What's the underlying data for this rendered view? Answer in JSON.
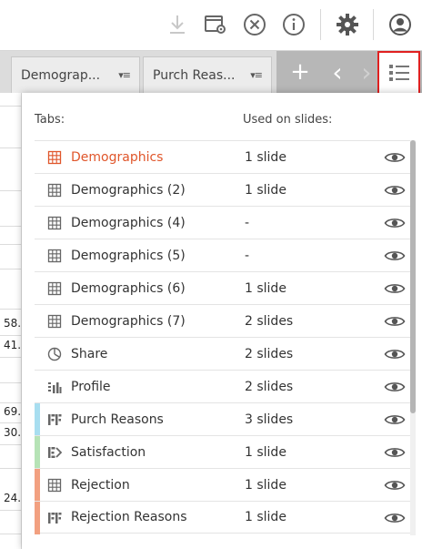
{
  "toolbar": {
    "icons": [
      "download-icon",
      "settings-window-icon",
      "close-circle-icon",
      "info-icon",
      "gear-icon",
      "user-icon"
    ]
  },
  "tabs": [
    {
      "label": "Demograp...",
      "menu_glyph": "▾≡"
    },
    {
      "label": "Purch Reas...",
      "menu_glyph": "▾≡"
    }
  ],
  "tab_controls": {
    "add": "+",
    "prev": "‹",
    "next": "›"
  },
  "background_sheet": {
    "values": [
      "58.",
      "41.",
      "69.",
      "30.",
      "24."
    ]
  },
  "popup": {
    "header_tabs": "Tabs:",
    "header_used": "Used on slides:",
    "rows": [
      {
        "name": "Demographics",
        "used": "1 slide",
        "icon": "table-icon",
        "active": true,
        "stripe": ""
      },
      {
        "name": "Demographics (2)",
        "used": "1 slide",
        "icon": "table-icon",
        "active": false,
        "stripe": ""
      },
      {
        "name": "Demographics (4)",
        "used": "-",
        "icon": "table-icon",
        "active": false,
        "stripe": ""
      },
      {
        "name": "Demographics (5)",
        "used": "-",
        "icon": "table-icon",
        "active": false,
        "stripe": ""
      },
      {
        "name": "Demographics (6)",
        "used": "1 slide",
        "icon": "table-icon",
        "active": false,
        "stripe": ""
      },
      {
        "name": "Demographics (7)",
        "used": "2 slides",
        "icon": "table-icon",
        "active": false,
        "stripe": ""
      },
      {
        "name": "Share",
        "used": "2 slides",
        "icon": "pie-chart-icon",
        "active": false,
        "stripe": ""
      },
      {
        "name": "Profile",
        "used": "2 slides",
        "icon": "profile-chart-icon",
        "active": false,
        "stripe": ""
      },
      {
        "name": "Purch Reasons",
        "used": "3 slides",
        "icon": "reasons-icon",
        "active": false,
        "stripe": "#a8def0"
      },
      {
        "name": "Satisfaction",
        "used": "1 slide",
        "icon": "satisfaction-icon",
        "active": false,
        "stripe": "#b6e3b6"
      },
      {
        "name": "Rejection",
        "used": "1 slide",
        "icon": "table-icon",
        "active": false,
        "stripe": "#f2a080"
      },
      {
        "name": "Rejection Reasons",
        "used": "1 slide",
        "icon": "reasons-icon",
        "active": false,
        "stripe": "#f2a080"
      }
    ]
  },
  "colors": {
    "accent": "#e0562b",
    "highlight_border": "#e02020",
    "icon": "#666666"
  }
}
